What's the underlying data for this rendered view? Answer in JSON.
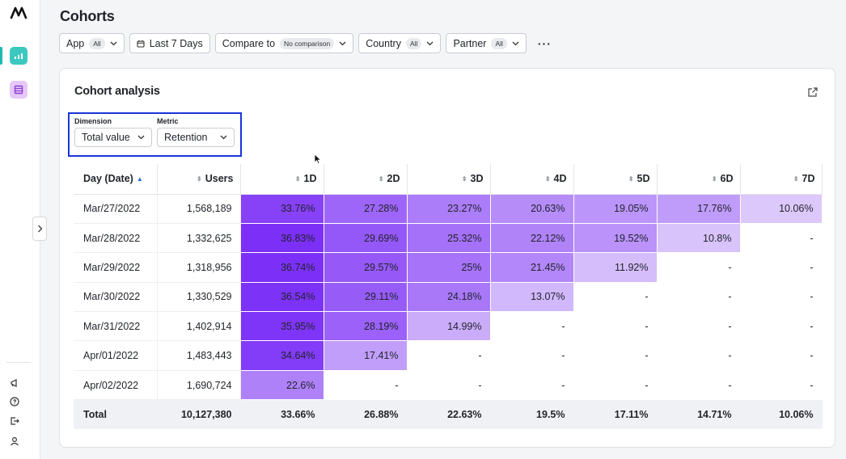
{
  "page": {
    "title": "Cohorts"
  },
  "filters": {
    "app": {
      "label": "App",
      "value": "All"
    },
    "date": {
      "label": "Last 7 Days"
    },
    "compare": {
      "label": "Compare to",
      "value": "No comparison"
    },
    "country": {
      "label": "Country",
      "value": "All"
    },
    "partner": {
      "label": "Partner",
      "value": "All"
    },
    "more": "···"
  },
  "card": {
    "title": "Cohort analysis",
    "dimension": {
      "label": "Dimension",
      "value": "Total value"
    },
    "metric": {
      "label": "Metric",
      "value": "Retention"
    }
  },
  "table": {
    "columns": [
      "Day (Date)",
      "Users",
      "1D",
      "2D",
      "3D",
      "4D",
      "5D",
      "6D",
      "7D"
    ],
    "rows": [
      {
        "date": "Mar/27/2022",
        "users": "1,568,189",
        "values": [
          "33.76%",
          "27.28%",
          "23.27%",
          "20.63%",
          "19.05%",
          "17.76%",
          "10.06%"
        ]
      },
      {
        "date": "Mar/28/2022",
        "users": "1,332,625",
        "values": [
          "36.83%",
          "29.69%",
          "25.32%",
          "22.12%",
          "19.52%",
          "10.8%",
          "-"
        ]
      },
      {
        "date": "Mar/29/2022",
        "users": "1,318,956",
        "values": [
          "36.74%",
          "29.57%",
          "25%",
          "21.45%",
          "11.92%",
          "-",
          "-"
        ]
      },
      {
        "date": "Mar/30/2022",
        "users": "1,330,529",
        "values": [
          "36.54%",
          "29.11%",
          "24.18%",
          "13.07%",
          "-",
          "-",
          "-"
        ]
      },
      {
        "date": "Mar/31/2022",
        "users": "1,402,914",
        "values": [
          "35.95%",
          "28.19%",
          "14.99%",
          "-",
          "-",
          "-",
          "-"
        ]
      },
      {
        "date": "Apr/01/2022",
        "users": "1,483,443",
        "values": [
          "34.64%",
          "17.41%",
          "-",
          "-",
          "-",
          "-",
          "-"
        ]
      },
      {
        "date": "Apr/02/2022",
        "users": "1,690,724",
        "values": [
          "22.6%",
          "-",
          "-",
          "-",
          "-",
          "-",
          "-"
        ]
      }
    ],
    "total": {
      "label": "Total",
      "users": "10,127,380",
      "values": [
        "33.66%",
        "26.88%",
        "22.63%",
        "19.5%",
        "17.11%",
        "14.71%",
        "10.06%"
      ]
    }
  },
  "colors": {
    "accent": "#1a33d9",
    "heat_dark": "#7b2ff7",
    "heat_light": "#dcc8fb"
  }
}
